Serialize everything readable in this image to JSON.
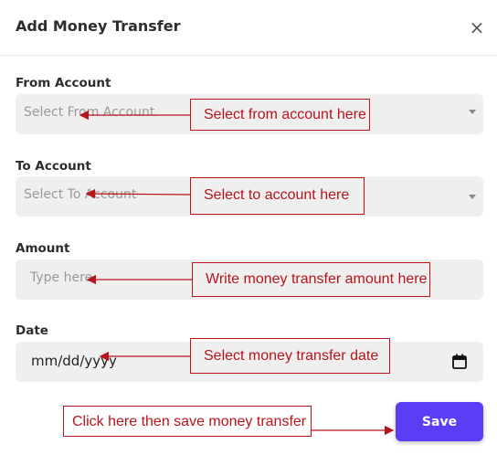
{
  "modal": {
    "title": "Add Money Transfer",
    "close_symbol": "×"
  },
  "form": {
    "from_account": {
      "label": "From Account",
      "placeholder": "Select From Account"
    },
    "to_account": {
      "label": "To Account",
      "placeholder": "Select To Account"
    },
    "amount": {
      "label": "Amount",
      "placeholder": "Type here"
    },
    "date": {
      "label": "Date",
      "value": "mm/dd/yyyy"
    }
  },
  "annotations": {
    "from_account": "Select from account here",
    "to_account": "Select to account here",
    "amount": "Write money transfer amount here",
    "date": "Select money transfer date",
    "save": "Click here then save money transfer"
  },
  "actions": {
    "save_label": "Save"
  },
  "colors": {
    "accent": "#5b3df5",
    "annotation": "#b8141b",
    "field_bg": "#efefef"
  },
  "icons": {
    "close": "close-icon",
    "calendar": "calendar-icon",
    "dropdown": "chevron-down-icon"
  }
}
